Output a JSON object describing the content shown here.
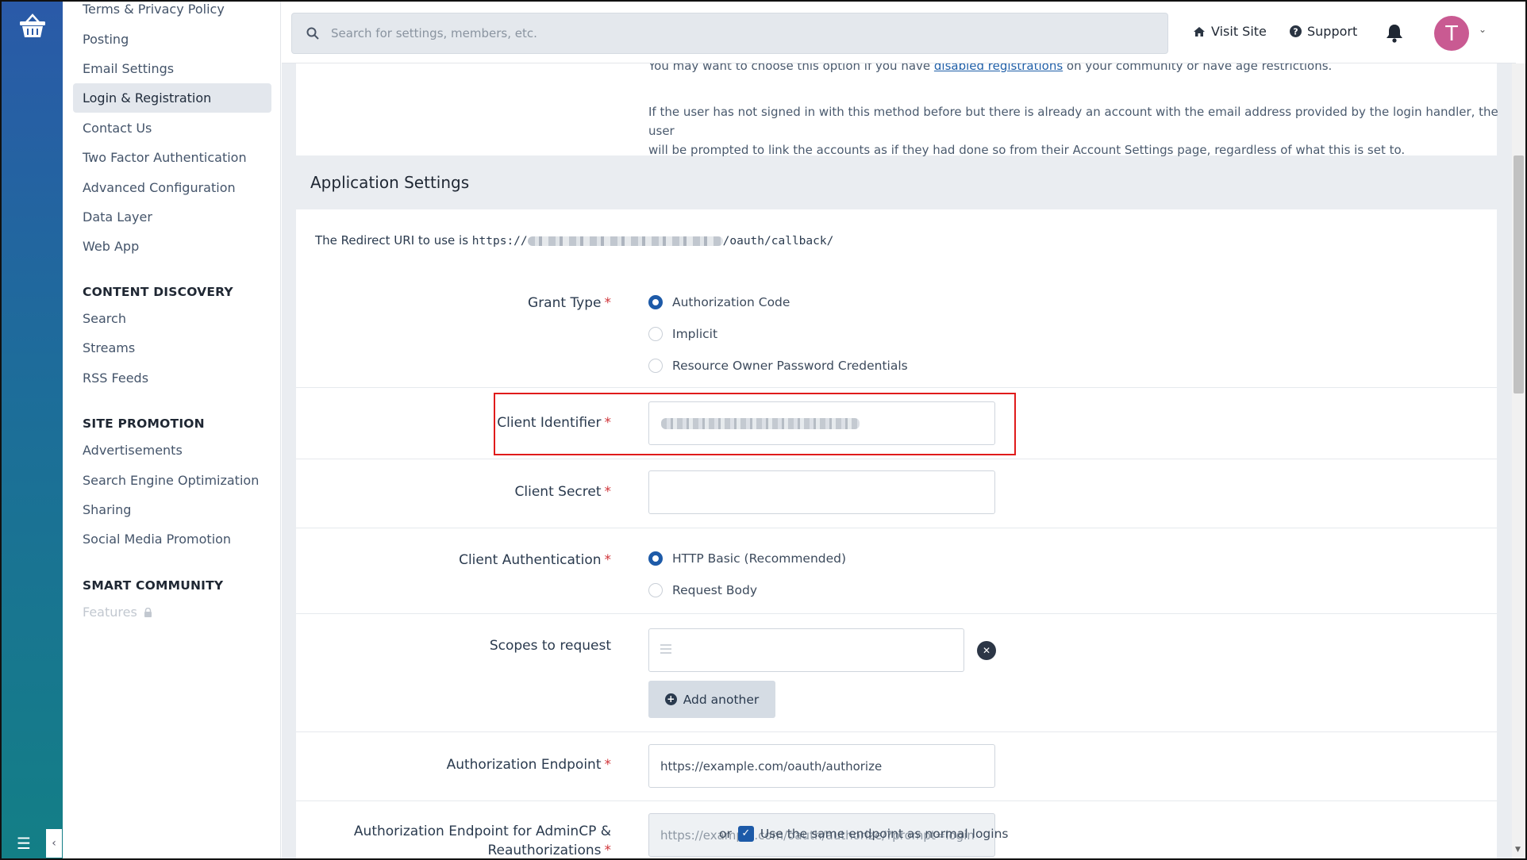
{
  "sidebar": {
    "items_top": [
      {
        "label": "Terms & Privacy Policy"
      },
      {
        "label": "Posting"
      },
      {
        "label": "Email Settings"
      },
      {
        "label": "Login & Registration",
        "active": true
      },
      {
        "label": "Contact Us"
      },
      {
        "label": "Two Factor Authentication"
      },
      {
        "label": "Advanced Configuration"
      },
      {
        "label": "Data Layer"
      },
      {
        "label": "Web App"
      }
    ],
    "content_discovery": {
      "heading": "CONTENT DISCOVERY",
      "items": [
        "Search",
        "Streams",
        "RSS Feeds"
      ]
    },
    "site_promotion": {
      "heading": "SITE PROMOTION",
      "items": [
        "Advertisements",
        "Search Engine Optimization",
        "Sharing",
        "Social Media Promotion"
      ]
    },
    "smart_community": {
      "heading": "SMART COMMUNITY",
      "items": [
        "Features"
      ]
    }
  },
  "header": {
    "search_placeholder": "Search for settings, members, etc.",
    "visit_site": "Visit Site",
    "support": "Support",
    "avatar_letter": "T"
  },
  "main": {
    "hint1_before": "You may want to choose this option if you have ",
    "hint1_link": "disabled registrations",
    "hint1_after": " on your community or have age restrictions.",
    "hint2_line1": "If the user has not signed in with this method before but there is already an account with the email address provided by the login handler, the user",
    "hint2_line2": "will be prompted to link the accounts as if they had done so from their Account Settings page, regardless of what this is set to.",
    "section_title": "Application Settings",
    "redirect_prefix": "The Redirect URI to use is ",
    "redirect_start": "https://",
    "redirect_end": "/oauth/callback/",
    "grant_type": {
      "label": "Grant Type",
      "options": [
        "Authorization Code",
        "Implicit",
        "Resource Owner Password Credentials"
      ],
      "selected": "Authorization Code"
    },
    "client_identifier": {
      "label": "Client Identifier"
    },
    "client_secret": {
      "label": "Client Secret",
      "value": ""
    },
    "client_auth": {
      "label": "Client Authentication",
      "options": [
        "HTTP Basic (Recommended)",
        "Request Body"
      ],
      "selected": "HTTP Basic (Recommended)"
    },
    "scopes": {
      "label": "Scopes to request",
      "add_label": "Add another"
    },
    "auth_endpoint": {
      "label": "Authorization Endpoint",
      "value": "https://example.com/oauth/authorize"
    },
    "auth_endpoint_admin": {
      "label_line1": "Authorization Endpoint for AdminCP &",
      "label_line2": "Reauthorizations",
      "value": "https://example.com/oauth/authorize/?prompt=login",
      "or": "or",
      "same_label": "Use the same endpoint as normal logins",
      "same_checked": true
    }
  },
  "colors": {
    "accent": "#1d5aa8",
    "required": "#d0353a",
    "highlight": "#e01b1b",
    "avatar": "#c95a92"
  }
}
